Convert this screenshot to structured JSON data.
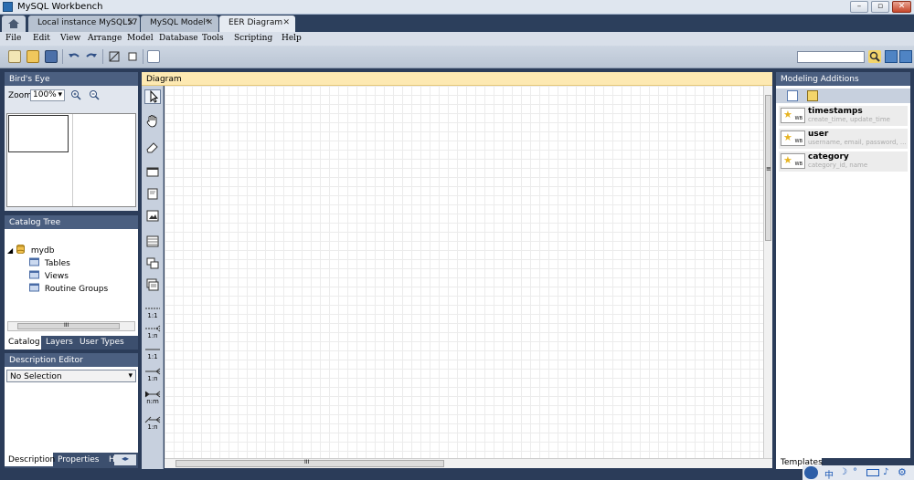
{
  "window": {
    "title": "MySQL Workbench"
  },
  "tabs": [
    {
      "label": "Local instance MySQL57"
    },
    {
      "label": "MySQL Model*"
    },
    {
      "label": "EER Diagram"
    }
  ],
  "menu": [
    "File",
    "Edit",
    "View",
    "Arrange",
    "Model",
    "Database",
    "Tools",
    "Scripting",
    "Help"
  ],
  "birdseye": {
    "title": "Bird's Eye",
    "zoom_label": "Zoom:",
    "zoom_value": "100%"
  },
  "catalog": {
    "title": "Catalog Tree",
    "schema": "mydb",
    "children": [
      "Tables",
      "Views",
      "Routine Groups"
    ],
    "scroll_label": "III",
    "tabs": [
      "Catalog",
      "Layers",
      "User Types"
    ]
  },
  "description": {
    "title": "Description Editor",
    "selection": "No Selection",
    "tabs": [
      "Description",
      "Properties",
      "H"
    ]
  },
  "diagram": {
    "title": "Diagram",
    "scroll_label": "III"
  },
  "palette": {
    "labels": [
      "1:1",
      "1:n",
      "1:1",
      "1:n",
      "n:m",
      "1:n"
    ]
  },
  "modeling": {
    "title": "Modeling Additions",
    "snippets": [
      {
        "name": "timestamps",
        "desc": "create_time, update_time"
      },
      {
        "name": "user",
        "desc": "username, email, password, ..."
      },
      {
        "name": "category",
        "desc": "category_id, name"
      }
    ],
    "templates_tab": "Templates"
  },
  "colors": {
    "panel_header": "#4b5f80",
    "diagram_header": "#fde9b2",
    "background": "#2b3c59"
  }
}
